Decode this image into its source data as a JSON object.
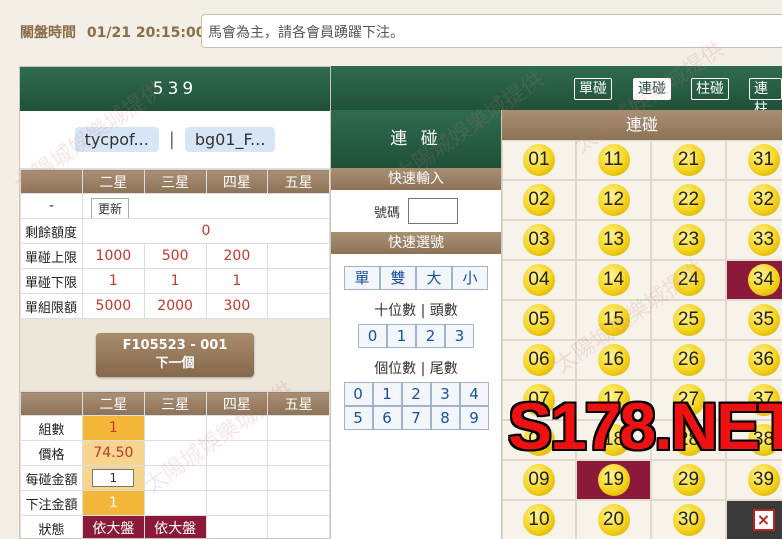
{
  "header": {
    "close_label": "關盤時間",
    "close_time": "01/21 20:15:00",
    "marquee": "馬會為主，請各會員踴躍下注。"
  },
  "game": {
    "title": "539"
  },
  "accounts": [
    "tycpof...",
    "bg01_F..."
  ],
  "limits": {
    "columns": [
      "二星",
      "三星",
      "四星",
      "五星"
    ],
    "dash": "-",
    "update_label": "更新",
    "rows": [
      {
        "label": "剩餘額度",
        "values": [
          "0"
        ]
      },
      {
        "label": "單碰上限",
        "values": [
          "1000",
          "500",
          "200",
          ""
        ]
      },
      {
        "label": "單碰下限",
        "values": [
          "1",
          "1",
          "1",
          ""
        ]
      },
      {
        "label": "單組限額",
        "values": [
          "5000",
          "2000",
          "300",
          ""
        ]
      }
    ]
  },
  "next": {
    "code": "F105523 - 001",
    "label": "下一個"
  },
  "bet": {
    "columns": [
      "二星",
      "三星",
      "四星",
      "五星"
    ],
    "rows": {
      "groups": {
        "label": "組數",
        "value": "1"
      },
      "price": {
        "label": "價格",
        "value": "74.50"
      },
      "each": {
        "label": "每碰金額",
        "value": "1"
      },
      "total": {
        "label": "下注金額",
        "value": "1"
      },
      "status": {
        "label": "狀態",
        "values": [
          "依大盤",
          "依大盤"
        ]
      }
    }
  },
  "middle": {
    "title": "連 碰",
    "quick_input": "快速輸入",
    "number_label": "號碼",
    "quick_select": "快速選號",
    "quick_buttons": [
      "單",
      "雙",
      "大",
      "小"
    ],
    "tens_label": "十位數 | 頭數",
    "tens": [
      "0",
      "1",
      "2",
      "3"
    ],
    "units_label": "個位數 | 尾數",
    "units_row1": [
      "0",
      "1",
      "2",
      "3",
      "4"
    ],
    "units_row2": [
      "5",
      "6",
      "7",
      "8",
      "9"
    ]
  },
  "modes": [
    "單碰",
    "連碰",
    "柱碰",
    "連柱"
  ],
  "numbers": {
    "title": "連碰",
    "rows": [
      [
        "01",
        "11",
        "21",
        "31"
      ],
      [
        "02",
        "12",
        "22",
        "32"
      ],
      [
        "03",
        "13",
        "23",
        "33"
      ],
      [
        "04",
        "14",
        "24",
        "34"
      ],
      [
        "05",
        "15",
        "25",
        "35"
      ],
      [
        "06",
        "16",
        "26",
        "36"
      ],
      [
        "07",
        "17",
        "27",
        "37"
      ],
      [
        "08",
        "18",
        "28",
        "38"
      ],
      [
        "09",
        "19",
        "29",
        "39"
      ],
      [
        "10",
        "20",
        "30",
        ""
      ]
    ],
    "selected": [
      "34",
      "19"
    ]
  },
  "overlay": {
    "stamp": "S178.NET",
    "watermark": "太陽城娛樂城提供"
  },
  "close_icon": "×"
}
